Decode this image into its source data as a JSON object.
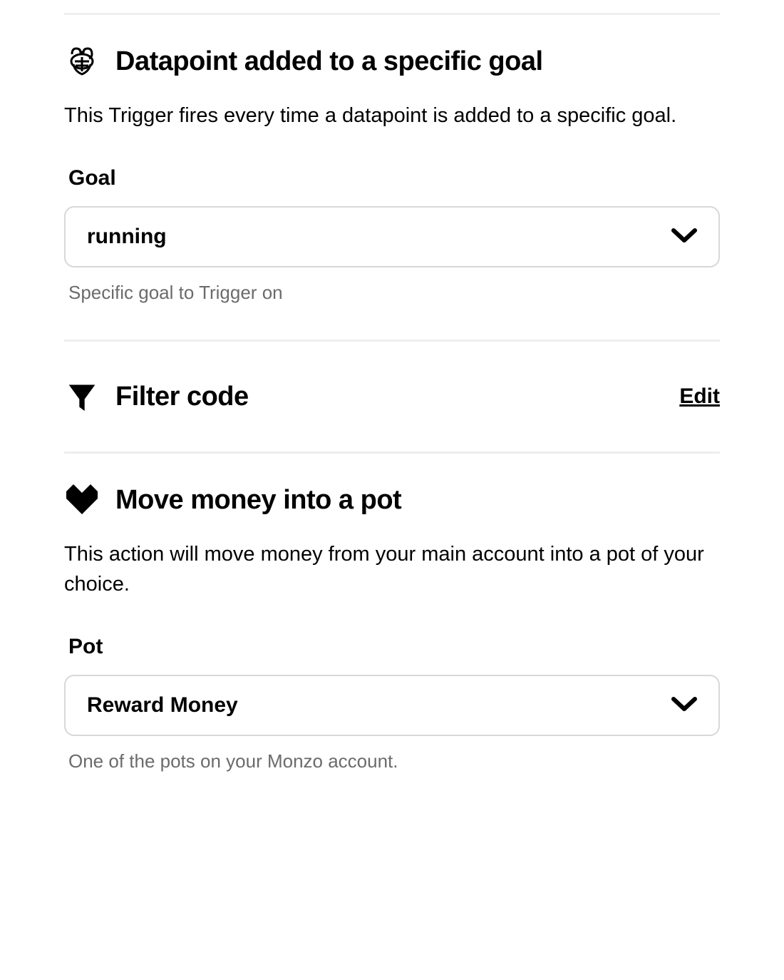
{
  "trigger": {
    "title": "Datapoint added to a specific goal",
    "description": "This Trigger fires every time a datapoint is added to a specific goal.",
    "field": {
      "label": "Goal",
      "value": "running",
      "hint": "Specific goal to Trigger on"
    }
  },
  "filter": {
    "title": "Filter code",
    "edit_label": "Edit"
  },
  "action": {
    "title": "Move money into a pot",
    "description": "This action will move money from your main account into a pot of your choice.",
    "field": {
      "label": "Pot",
      "value": "Reward Money",
      "hint": "One of the pots on your Monzo account."
    }
  }
}
